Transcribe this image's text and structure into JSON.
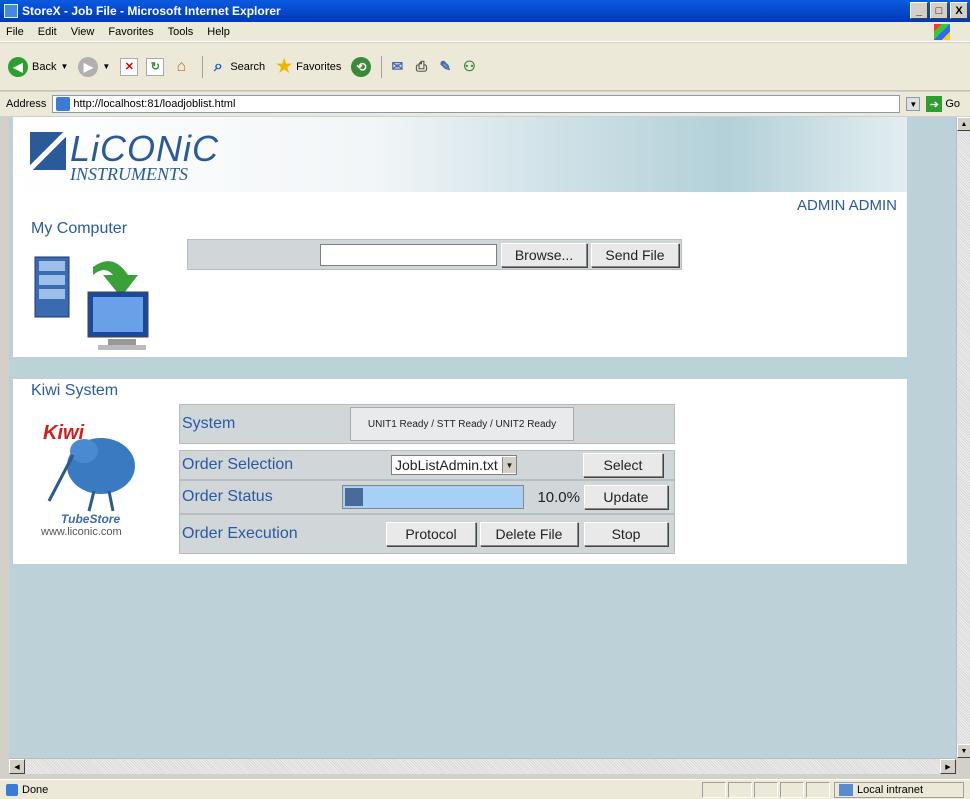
{
  "window": {
    "title": "StoreX - Job File - Microsoft Internet Explorer",
    "controls": [
      "_",
      "□",
      "X"
    ]
  },
  "menu": [
    "File",
    "Edit",
    "View",
    "Favorites",
    "Tools",
    "Help"
  ],
  "toolbar": {
    "back": "Back",
    "search": "Search",
    "favorites": "Favorites"
  },
  "address": {
    "label": "Address",
    "url": "http://localhost:81/loadjoblist.html",
    "go": "Go"
  },
  "page": {
    "logo_main": "LiCONiC",
    "logo_sub": "INSTRUMENTS",
    "user": "ADMIN ADMIN",
    "my_computer": {
      "title": "My Computer",
      "browse_label": "Browse...",
      "send_label": "Send File"
    },
    "kiwi": {
      "title": "Kiwi System",
      "logo_text": "Kiwi",
      "logo_sub": "TubeStore",
      "url": "www.liconic.com",
      "rows": {
        "system_label": "System",
        "system_status": "UNIT1 Ready / STT Ready / UNIT2 Ready",
        "order_selection_label": "Order Selection",
        "selected_file": "JobListAdmin.txt",
        "select_button": "Select",
        "order_status_label": "Order Status",
        "progress_fraction": 0.1,
        "progress_text": "10.0%",
        "update_button": "Update",
        "order_execution_label": "Order Execution",
        "protocol_button": "Protocol",
        "delete_button": "Delete File",
        "stop_button": "Stop"
      }
    }
  },
  "status": {
    "text": "Done",
    "zone": "Local intranet"
  }
}
